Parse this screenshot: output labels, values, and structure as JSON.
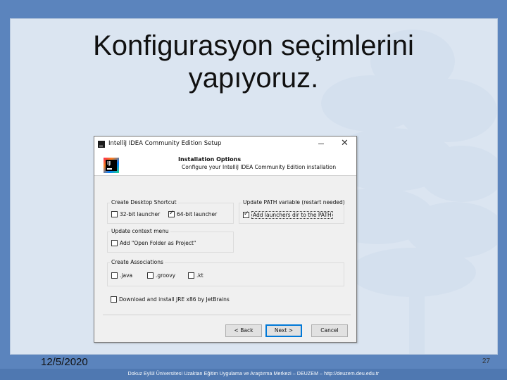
{
  "slide": {
    "title": "Konfigurasyon seçimlerini\nyapıyoruz.",
    "date": "12/5/2020",
    "page_number": "27",
    "footer": "Dokuz Eylül Üniversitesi Uzaktan Eğitim Uygulama ve Araştırma Merkezi – DEUZEM – http://deuzem.deu.edu.tr"
  },
  "dialog": {
    "window_title": "IntelliJ IDEA Community Edition Setup",
    "logo_text": "IJ",
    "header_title": "Installation Options",
    "header_subtitle": "Configure your IntelliJ IDEA Community Edition installation",
    "groups": {
      "desktop_shortcut": {
        "label": "Create Desktop Shortcut",
        "options": [
          {
            "label": "32-bit launcher",
            "checked": false
          },
          {
            "label": "64-bit launcher",
            "checked": true
          }
        ]
      },
      "path_variable": {
        "label": "Update PATH variable (restart needed)",
        "options": [
          {
            "label": "Add launchers dir to the PATH",
            "checked": true
          }
        ]
      },
      "context_menu": {
        "label": "Update context menu",
        "options": [
          {
            "label": "Add \"Open Folder as Project\"",
            "checked": false
          }
        ]
      },
      "associations": {
        "label": "Create Associations",
        "options": [
          {
            "label": ".java",
            "checked": false
          },
          {
            "label": ".groovy",
            "checked": false
          },
          {
            "label": ".kt",
            "checked": false
          }
        ]
      }
    },
    "jre_option": {
      "label": "Download and install JRE x86 by JetBrains",
      "checked": false
    },
    "buttons": {
      "back": "< Back",
      "next": "Next >",
      "cancel": "Cancel"
    }
  }
}
